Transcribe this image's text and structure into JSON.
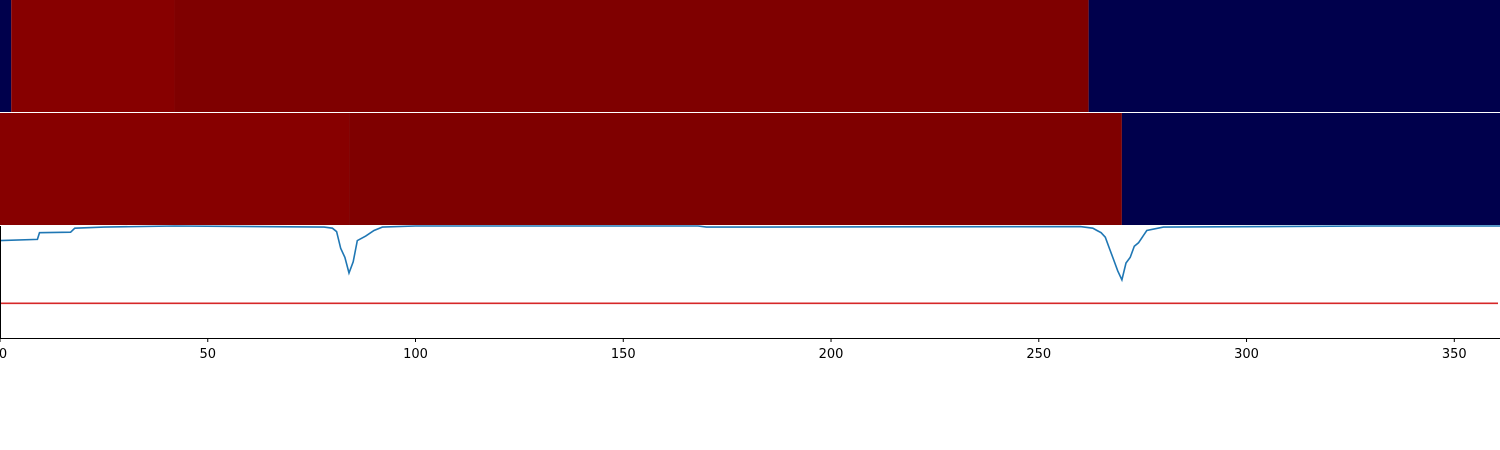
{
  "chart_data": {
    "type": "heatmap",
    "x_range": [
      0,
      361
    ],
    "x_ticks": [
      0,
      50,
      100,
      150,
      200,
      250,
      300,
      350
    ],
    "x_tick_labels": [
      "0",
      "50",
      "100",
      "150",
      "200",
      "250",
      "300",
      "350"
    ],
    "colors": {
      "high_red": "#870000",
      "mid_red": "#7f0000",
      "low_blue": "#00004c",
      "line": "#1f77b4",
      "threshold": "#d62728",
      "axis": "#000000",
      "background": "#ffffff"
    },
    "bands": [
      {
        "segments": [
          {
            "x0": 0,
            "x1": 2.7,
            "color": "#00004c"
          },
          {
            "x0": 2.7,
            "x1": 42,
            "color": "#870000"
          },
          {
            "x0": 42,
            "x1": 262,
            "color": "#7f0000"
          },
          {
            "x0": 262,
            "x1": 361,
            "color": "#00004c"
          }
        ]
      },
      {
        "segments": [
          {
            "x0": 0,
            "x1": 84,
            "color": "#870000"
          },
          {
            "x0": 84,
            "x1": 270,
            "color": "#7f0000"
          },
          {
            "x0": 270,
            "x1": 361,
            "color": "#00004c"
          }
        ]
      }
    ],
    "line_series": {
      "y_range": [
        0,
        1
      ],
      "threshold": 0.31,
      "x": [
        0,
        9,
        9.5,
        17,
        18,
        25,
        42,
        78,
        80,
        81,
        82,
        83,
        84,
        85,
        86,
        88,
        90,
        92,
        100,
        168,
        170,
        260,
        263,
        264,
        265,
        266,
        267,
        268,
        269,
        270,
        271,
        272,
        273,
        274,
        276,
        280,
        330,
        361
      ],
      "y": [
        0.87,
        0.88,
        0.94,
        0.945,
        0.98,
        0.99,
        1.0,
        0.99,
        0.98,
        0.95,
        0.8,
        0.72,
        0.58,
        0.68,
        0.87,
        0.91,
        0.96,
        0.99,
        1.0,
        1.0,
        0.99,
        0.995,
        0.98,
        0.96,
        0.94,
        0.9,
        0.8,
        0.7,
        0.6,
        0.52,
        0.67,
        0.72,
        0.82,
        0.85,
        0.96,
        0.99,
        1.0,
        1.0
      ]
    }
  }
}
